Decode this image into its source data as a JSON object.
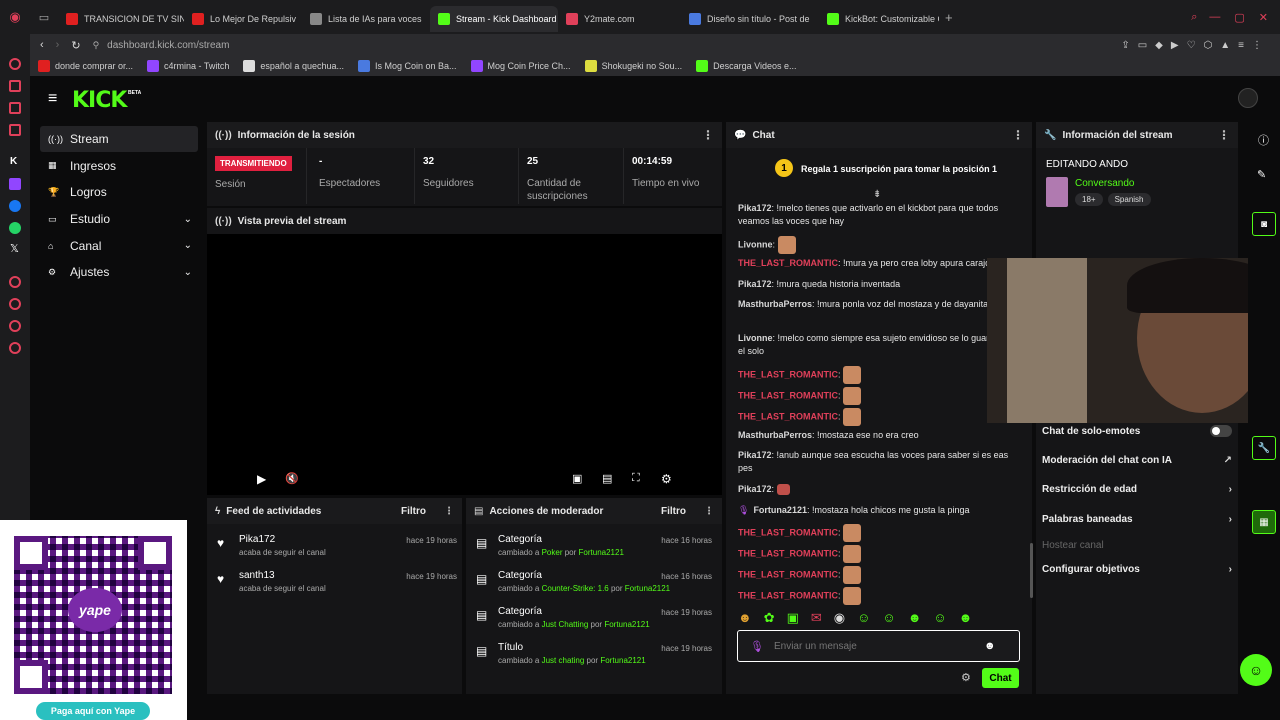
{
  "browser": {
    "tabs": [
      {
        "label": "TRANSICION DE TV SIN S",
        "color": "#e02020"
      },
      {
        "label": "Lo Mejor De Repulsiv",
        "color": "#e02020"
      },
      {
        "label": "Lista de IAs para voces",
        "color": "#888888"
      },
      {
        "label": "Stream - Kick Dashboard",
        "color": "#53fc18",
        "active": true
      },
      {
        "label": "Y2mate.com",
        "color": "#e0405a"
      },
      {
        "label": "Diseño sin título - Post de",
        "color": "#4a7ae0"
      },
      {
        "label": "KickBot: Customizable Ch",
        "color": "#53fc18"
      }
    ],
    "url": "dashboard.kick.com/stream",
    "bookmarks": [
      "donde comprar or...",
      "c4rmina - Twitch",
      "español a quechua...",
      "Is Mog Coin on Ba...",
      "Mog Coin Price Ch...",
      "Shokugeki no Sou...",
      "Descarga Videos e..."
    ]
  },
  "kick": {
    "logo": "KICK",
    "beta": "BETA",
    "nav": [
      {
        "label": "Stream",
        "active": true
      },
      {
        "label": "Ingresos"
      },
      {
        "label": "Logros"
      },
      {
        "label": "Estudio",
        "chevron": true
      },
      {
        "label": "Canal",
        "chevron": true
      },
      {
        "label": "Ajustes",
        "chevron": true
      }
    ],
    "session": {
      "title": "Información de la sesión",
      "badge": "TRANSMITIENDO",
      "session_label": "Sesión",
      "stats": [
        {
          "value": "-",
          "label": "Espectadores"
        },
        {
          "value": "32",
          "label": "Seguidores"
        },
        {
          "value": "25",
          "label": "Cantidad de suscripciones"
        },
        {
          "value": "00:14:59",
          "label": "Tiempo en vivo"
        }
      ]
    },
    "preview": {
      "title": "Vista previa del stream"
    },
    "feed": {
      "title": "Feed de actividades",
      "filter": "Filtro",
      "items": [
        {
          "name": "Pika172",
          "sub": "acaba de seguir el canal",
          "time": "hace 19 horas"
        },
        {
          "name": "santh13",
          "sub": "acaba de seguir el canal",
          "time": "hace 19 horas"
        }
      ]
    },
    "mod": {
      "title": "Acciones de moderador",
      "filter": "Filtro",
      "items": [
        {
          "name": "Categoría",
          "pre": "cambiado a",
          "value": "Poker",
          "by": "por",
          "user": "Fortuna2121",
          "time": "hace 16 horas"
        },
        {
          "name": "Categoría",
          "pre": "cambiado a",
          "value": "Counter-Strike: 1.6",
          "by": "por",
          "user": "Fortuna2121",
          "time": "hace 16 horas"
        },
        {
          "name": "Categoría",
          "pre": "cambiado a",
          "value": "Just Chatting",
          "by": "por",
          "user": "Fortuna2121",
          "time": "hace 19 horas"
        },
        {
          "name": "Título",
          "pre": "cambiado a",
          "value": "Just chating",
          "by": "por",
          "user": "Fortuna2121",
          "time": "hace 19 horas"
        }
      ]
    },
    "chat": {
      "title": "Chat",
      "gift": "Regala 1 suscripción para tomar la posición 1",
      "gift_num": "1",
      "messages": [
        {
          "user": "Pika172",
          "text": ": !melco tienes que activarlo en el kickbot para que todos veamos las voces que hay"
        },
        {
          "user": "Livonne",
          "text": ":"
        },
        {
          "user": "THE_LAST_ROMANTIC",
          "text": ": !mura ya pero crea loby apura carajo"
        },
        {
          "user": "Pika172",
          "text": ": !mura queda historia inventada"
        },
        {
          "user": "MasthurbaPerros",
          "text": ": !mura ponla voz del mostaza y de dayanita mierda"
        },
        {
          "user": "Livonne",
          "text": ": !melco como siempre esa sujeto envidioso se lo guarda para el solo"
        },
        {
          "user": "THE_LAST_ROMANTIC",
          "text": ":"
        },
        {
          "user": "THE_LAST_ROMANTIC",
          "text": ":"
        },
        {
          "user": "THE_LAST_ROMANTIC",
          "text": ":"
        },
        {
          "user": "MasthurbaPerros",
          "text": ": !mostaza ese no era creo"
        },
        {
          "user": "Pika172",
          "text": ": !anub aunque sea escucha las voces para saber si es eas pes"
        },
        {
          "user": "Pika172",
          "text": ":"
        },
        {
          "user": "Fortuna2121",
          "text": ": !mostaza hola chicos me gusta la pinga"
        },
        {
          "user": "THE_LAST_ROMANTIC",
          "text": ":"
        },
        {
          "user": "THE_LAST_ROMANTIC",
          "text": ":"
        },
        {
          "user": "THE_LAST_ROMANTIC",
          "text": ":"
        },
        {
          "user": "THE_LAST_ROMANTIC",
          "text": ":"
        }
      ],
      "placeholder": "Enviar un mensaje",
      "send": "Chat"
    },
    "streaminfo": {
      "title": "Información del stream",
      "stream_title": "EDITANDO ANDO",
      "category": "Conversando",
      "tags": [
        "18+",
        "Spanish"
      ],
      "settings": [
        {
          "label": "Chat de solo-emotes",
          "toggle": true
        },
        {
          "label": "Moderación del chat con IA",
          "ext": true
        },
        {
          "label": "Restricción de edad",
          "chev": true
        },
        {
          "label": "Palabras baneadas",
          "chev": true
        },
        {
          "label": "Hostear canal",
          "disabled": true
        },
        {
          "label": "Configurar objetivos",
          "chev": true
        }
      ]
    },
    "qr": {
      "brand": "yape",
      "cta": "Paga aquí con Yape"
    }
  }
}
